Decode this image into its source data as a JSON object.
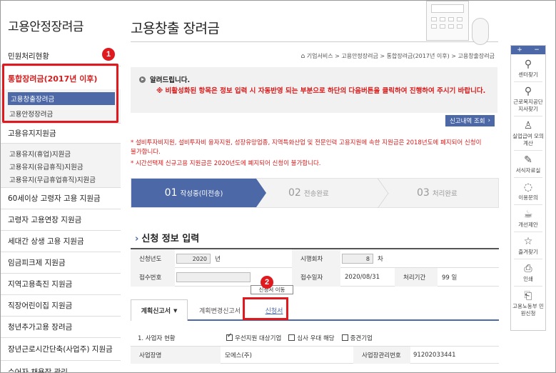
{
  "sidebar": {
    "title": "고용안정장려금",
    "items": [
      {
        "label": "민원처리현황"
      },
      {
        "label": "통합장려금(2017년 이후)"
      },
      {
        "label": "고용유지지원금"
      },
      {
        "label": "60세이상 고령자 고용 지원금"
      },
      {
        "label": "고령자 고용연장 지원금"
      },
      {
        "label": "세대간 상생 고용 지원금"
      },
      {
        "label": "임금피크제 지원금"
      },
      {
        "label": "지역고용촉진 지원금"
      },
      {
        "label": "직장어린이집 지원금"
      },
      {
        "label": "청년추가고용 장려금"
      },
      {
        "label": "장년근로시간단축(사업주) 지원금"
      },
      {
        "label": "수어자 채용장 관리"
      }
    ],
    "integrated_sub": [
      {
        "label": "고용창출장려금"
      },
      {
        "label": "고용안정장려금"
      }
    ],
    "retention_sub": [
      {
        "label": "고용유지(휴업)지원금"
      },
      {
        "label": "고용유지(유급휴직)지원금"
      },
      {
        "label": "고용유지(무급휴업휴직)지원금"
      }
    ]
  },
  "badges": {
    "one": "1",
    "two": "2"
  },
  "main": {
    "title": "고용창출 장려금",
    "breadcrumb": "기업서비스 > 고용안정장려금 > 통합장려금(2017년 이후) > 고용창출장려금",
    "notice_title": "알려드립니다.",
    "notice_body": "※ 비활성화된 항목은 정보 입력 시 자동반영 되는 부분으로 하단의 다음버튼을 클릭하여 진행하여 주시기 바랍니다.",
    "report_button": "신고내역 조회",
    "warning1": "* 설비투자비지원, 설비투자비 융자지원, 성장유망업종, 지역특화산업 및 전문인력 고용지원에 속한 지원금은 2018년도에 폐지되어 신청이 불가합니다.",
    "warning2": "* 시간선택제 신규고용 지원금은 2020년도에 폐지되어 신청이 불가합니다.",
    "steps": [
      {
        "num": "01",
        "label": "작성중(미전송)"
      },
      {
        "num": "02",
        "label": "전송완료"
      },
      {
        "num": "03",
        "label": "처리완료"
      }
    ],
    "section_title": "신청 정보 입력",
    "form": {
      "year_label": "신청년도",
      "year_value": "2020",
      "year_unit": "년",
      "round_label": "시행회차",
      "round_value": "8",
      "round_unit": "차",
      "receipt_label": "접수번호",
      "receipt_value": "",
      "date_label": "접수일자",
      "date_value": "2020/08/31",
      "period_label": "처리기간",
      "period_value": "99 일"
    },
    "tabs": [
      {
        "label": "계획신고서"
      },
      {
        "label": "계획변경신고서"
      },
      {
        "label": "신청서"
      }
    ],
    "tab_tooltip": "신청서 이동",
    "grid": {
      "biz_status_label": "1. 사업자 현황",
      "opt1": "우선지원 대상기업",
      "opt2": "심사 우대 해당",
      "opt3": "중견기업",
      "biz_name_label": "사업장명",
      "biz_name_value": "모에스(주)",
      "biz_no_label": "사업장관리번호",
      "biz_no_value": "91202033441"
    }
  },
  "quick_menu": {
    "head_plus": "+",
    "head_minus": "−",
    "items": [
      {
        "label": "센터찾기",
        "icon": "map-pin-icon"
      },
      {
        "label": "근로복지공단 지사찾기",
        "icon": "map-pin-icon"
      },
      {
        "label": "실업급여 모의계산",
        "icon": "person-icon"
      },
      {
        "label": "서식자료실",
        "icon": "edit-icon"
      },
      {
        "label": "이용문의",
        "icon": "chat-icon"
      },
      {
        "label": "개선제안",
        "icon": "coffee-icon"
      },
      {
        "label": "즐겨찾기",
        "icon": "star-icon"
      },
      {
        "label": "인쇄",
        "icon": "print-icon"
      },
      {
        "label": "고용노동부 민원신청",
        "icon": "document-icon"
      }
    ]
  }
}
